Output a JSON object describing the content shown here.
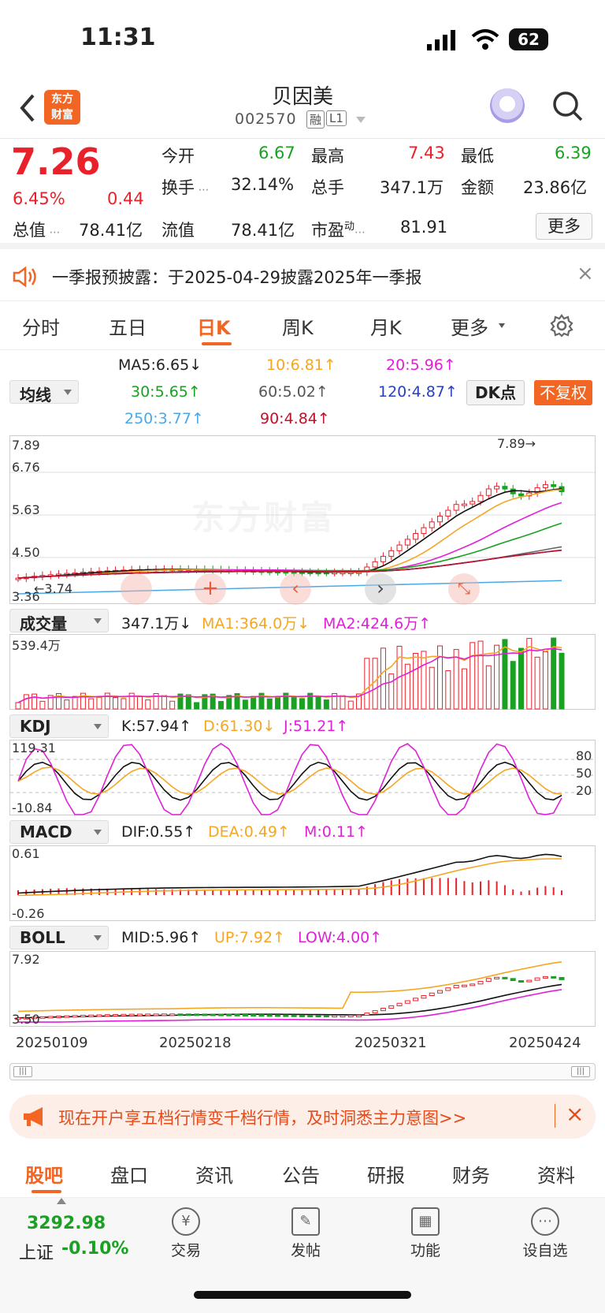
{
  "status": {
    "time": "11:31",
    "battery": "62"
  },
  "header": {
    "stock_name": "贝因美",
    "stock_code": "002570",
    "badge_rong": "融",
    "badge_level": "L1",
    "brand_logo": "东方\n财富",
    "icons": [
      "back-arrow-icon",
      "robot-avatar-icon",
      "search-icon"
    ]
  },
  "quote": {
    "price": "7.26",
    "change_pct": "6.45%",
    "change_abs": "0.44",
    "fields": [
      {
        "label": "今开",
        "value": "6.67",
        "color": "green"
      },
      {
        "label": "最高",
        "value": "7.43",
        "color": "red"
      },
      {
        "label": "最低",
        "value": "6.39",
        "color": "green"
      },
      {
        "label": "换手",
        "value": "32.14%",
        "color": "black"
      },
      {
        "label": "总手",
        "value": "347.1万",
        "color": "black"
      },
      {
        "label": "金额",
        "value": "23.86亿",
        "color": "black"
      },
      {
        "label": "总值",
        "value": "78.41亿",
        "color": "black"
      },
      {
        "label": "流值",
        "value": "78.41亿",
        "color": "black"
      },
      {
        "label": "市盈动",
        "value": "81.91",
        "color": "black"
      }
    ],
    "more_button": "更多"
  },
  "notice": {
    "text": "一季报预披露：于2025-04-29披露2025年一季报"
  },
  "tabs": [
    "分时",
    "五日",
    "日K",
    "周K",
    "月K",
    "更多"
  ],
  "active_tab": "日K",
  "ma": {
    "selector": "均线",
    "ma5": "MA5:6.65",
    "ma10": "10:6.81",
    "ma20": "20:5.96",
    "ma30": "30:5.65",
    "ma60": "60:5.02",
    "ma120": "120:4.87",
    "ma250": "250:3.77",
    "ma90": "90:4.84",
    "dk_button": "DK点",
    "fq_button": "不复权"
  },
  "kchart": {
    "ticks": [
      "7.89",
      "6.76",
      "5.63",
      "4.50",
      "3.36"
    ],
    "peak_label": "7.89",
    "low_label": "3.74",
    "watermark": "东方财富"
  },
  "volume": {
    "selector": "成交量",
    "vol": "347.1万",
    "ma1": "MA1:364.0万",
    "ma2": "MA2:424.6万",
    "top_tick": "539.4万"
  },
  "kdj": {
    "selector": "KDJ",
    "k": "K:57.94",
    "d": "D:61.30",
    "j": "J:51.21",
    "top_tick": "119.31",
    "bottom_tick": "-10.84",
    "levels": [
      "80",
      "50",
      "20"
    ]
  },
  "macd": {
    "selector": "MACD",
    "dif": "DIF:0.55",
    "dea": "DEA:0.49",
    "m": "M:0.11",
    "top_tick": "0.61",
    "bottom_tick": "-0.26"
  },
  "boll": {
    "selector": "BOLL",
    "mid": "MID:5.96",
    "up": "UP:7.92",
    "low": "LOW:4.00",
    "top_tick": "7.92",
    "bottom_tick": "3.50"
  },
  "dates": [
    "20250109",
    "20250218",
    "20250321",
    "20250424"
  ],
  "promo": {
    "text": "现在开户享五档行情变千档行情，及时洞悉主力意图>>"
  },
  "bottom_nav": [
    "股吧",
    "盘口",
    "资讯",
    "公告",
    "研报",
    "财务",
    "资料"
  ],
  "active_bottom": "股吧",
  "dock": {
    "index_value": "3292.98",
    "index_label": "上证",
    "index_change": "-0.10%",
    "items": [
      "交易",
      "发帖",
      "功能",
      "设自选"
    ]
  },
  "colors": {
    "up": "#e8212a",
    "down": "#1aa124",
    "accent": "#f26522"
  }
}
